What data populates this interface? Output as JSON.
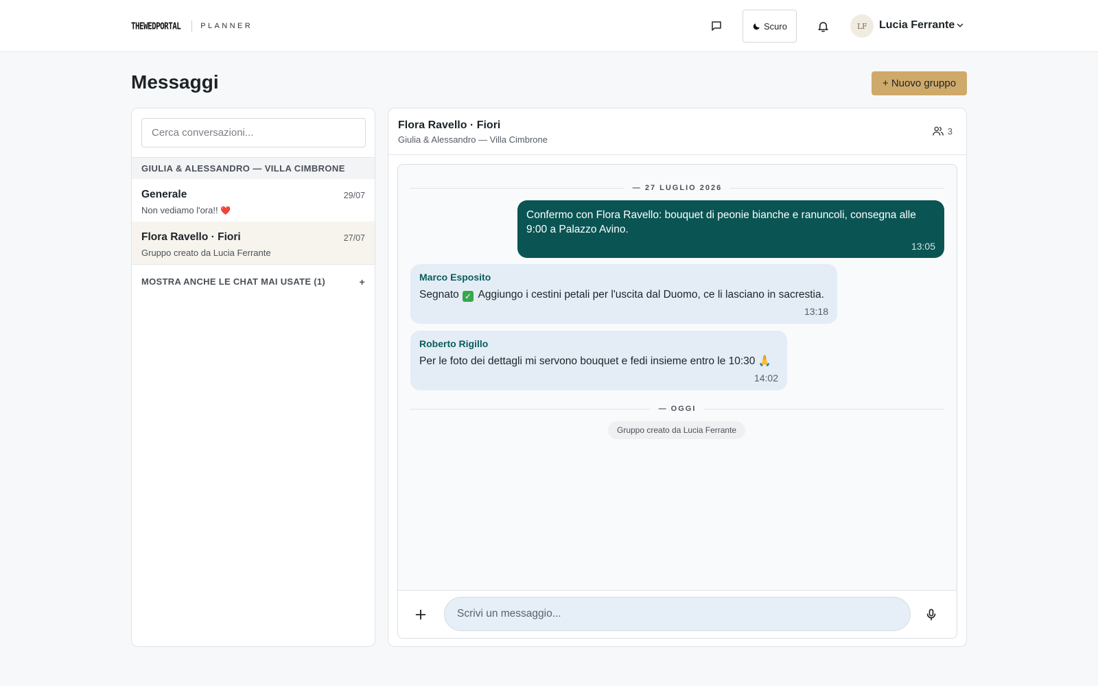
{
  "brand": {
    "logo": "THEWEDPORTAL",
    "product": "PLANNER"
  },
  "topbar": {
    "theme_label": "Scuro",
    "user_initials": "LF",
    "user_name": "Lucia Ferrante",
    "icons": [
      "chat-bubble-icon",
      "moon-icon",
      "bell-icon",
      "chevron-down-icon"
    ]
  },
  "page": {
    "title": "Messaggi",
    "new_group_label": "+ Nuovo gruppo"
  },
  "sidebar": {
    "search_placeholder": "Cerca conversazioni...",
    "group_header": "GIULIA & ALESSANDRO — VILLA CIMBRONE",
    "conversations": [
      {
        "name": "Generale",
        "date": "29/07",
        "preview": "Non vediamo l'ora!!",
        "emoji": "❤️",
        "active": false
      },
      {
        "name": "Flora Ravello · Fiori",
        "date": "27/07",
        "preview": "Gruppo creato da Lucia Ferrante",
        "active": true
      }
    ],
    "show_more_label": "MOSTRA ANCHE LE CHAT MAI USATE (1)",
    "show_more_icon": "+"
  },
  "chat": {
    "title": "Flora Ravello · Fiori",
    "subtitle": "Giulia & Alessandro — Villa Cimbrone",
    "member_count": "3",
    "separators": [
      "— 27 LUGLIO 2026",
      "— OGGI"
    ],
    "messages": [
      {
        "direction": "out",
        "text": "Confermo con Flora Ravello: bouquet di peonie bianche e ranuncoli, consegna alle 9:00 a Palazzo Avino.",
        "time": "13:05"
      },
      {
        "direction": "in",
        "sender": "Marco Esposito",
        "text_before": "Segnato",
        "emoji": "✅",
        "text_after": "Aggiungo i cestini petali per l'uscita dal Duomo, ce li lasciano in sacrestia.",
        "time": "13:18"
      },
      {
        "direction": "in",
        "sender": "Roberto Rigillo",
        "text": "Per le foto dei dettagli mi servono bouquet e fedi insieme entro le 10:30",
        "emoji": "🙏",
        "time": "14:02"
      }
    ],
    "system_message": "Gruppo creato da Lucia Ferrante",
    "composer_placeholder": "Scrivi un messaggio..."
  },
  "colors": {
    "accent_gold": "#cfa96a",
    "outgoing_bubble": "#0b5454",
    "incoming_bubble": "#e4edf6",
    "sender_name": "#0b5b5b"
  }
}
